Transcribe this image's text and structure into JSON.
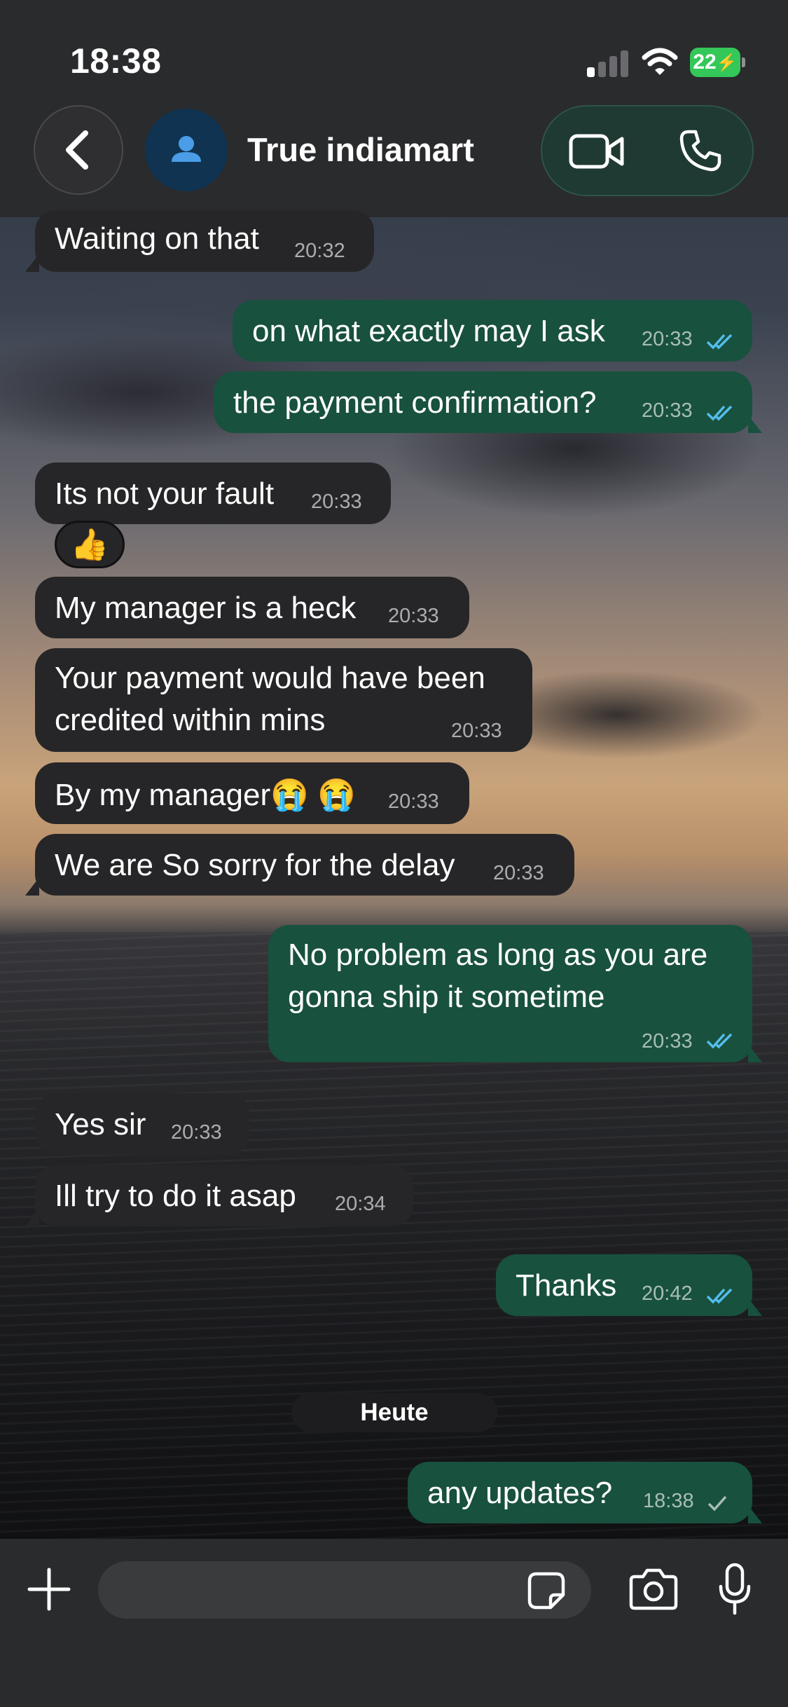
{
  "status_bar": {
    "time": "18:38",
    "battery": "22"
  },
  "header": {
    "contact_name": "True indiamart"
  },
  "messages": [
    {
      "text": "Waiting on that",
      "time": "20:32"
    },
    {
      "text": "on what exactly may I ask",
      "time": "20:33"
    },
    {
      "text": "the payment confirmation?",
      "time": "20:33"
    },
    {
      "text": "Its not your fault",
      "time": "20:33",
      "reaction": "👍"
    },
    {
      "text": "My manager is a heck",
      "time": "20:33"
    },
    {
      "text_line1": "Your payment would have been",
      "text_line2": "credited within mins",
      "time": "20:33"
    },
    {
      "text": "By my manager😭 😭",
      "time": "20:33"
    },
    {
      "text": "We are So sorry for the delay",
      "time": "20:33"
    },
    {
      "text_line1": "No problem as long as you are",
      "text_line2": "gonna ship it sometime",
      "time": "20:33"
    },
    {
      "text": "Yes sir",
      "time": "20:33"
    },
    {
      "text": "Ill try to do it asap",
      "time": "20:34"
    },
    {
      "text": "Thanks",
      "time": "20:42"
    },
    {
      "text": "any updates?",
      "time": "18:38"
    }
  ],
  "day_separator": "Heute",
  "composer": {
    "placeholder": ""
  },
  "colors": {
    "incoming": "#262628",
    "outgoing": "#18513d",
    "read_tick": "#53bdeb",
    "battery": "#34c759"
  },
  "icons": [
    "back-chevron-icon",
    "person-icon",
    "video-call-icon",
    "phone-icon",
    "plus-icon",
    "sticker-icon",
    "camera-icon",
    "microphone-icon"
  ]
}
